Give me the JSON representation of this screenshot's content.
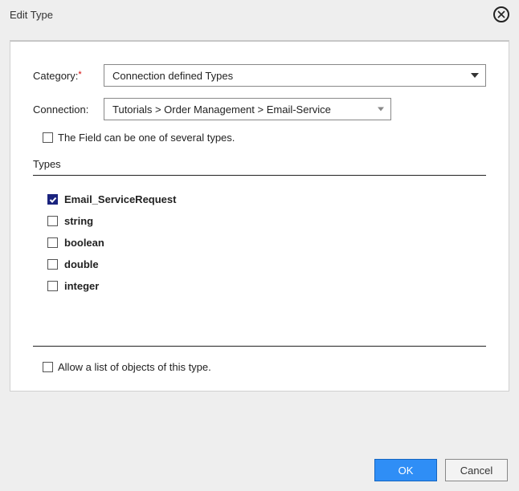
{
  "dialog": {
    "title": "Edit Type"
  },
  "form": {
    "category": {
      "label": "Category:",
      "value": "Connection defined Types"
    },
    "connection": {
      "label": "Connection:",
      "value": "Tutorials > Order Management > Email-Service"
    },
    "severalTypes": {
      "label": "The Field can be one of several types.",
      "checked": false
    }
  },
  "typesSection": {
    "title": "Types",
    "items": [
      {
        "label": "Email_ServiceRequest",
        "checked": true
      },
      {
        "label": "string",
        "checked": false
      },
      {
        "label": "boolean",
        "checked": false
      },
      {
        "label": "double",
        "checked": false
      },
      {
        "label": "integer",
        "checked": false
      }
    ]
  },
  "allowList": {
    "label": "Allow a list of objects of this type.",
    "checked": false
  },
  "buttons": {
    "ok": "OK",
    "cancel": "Cancel"
  }
}
